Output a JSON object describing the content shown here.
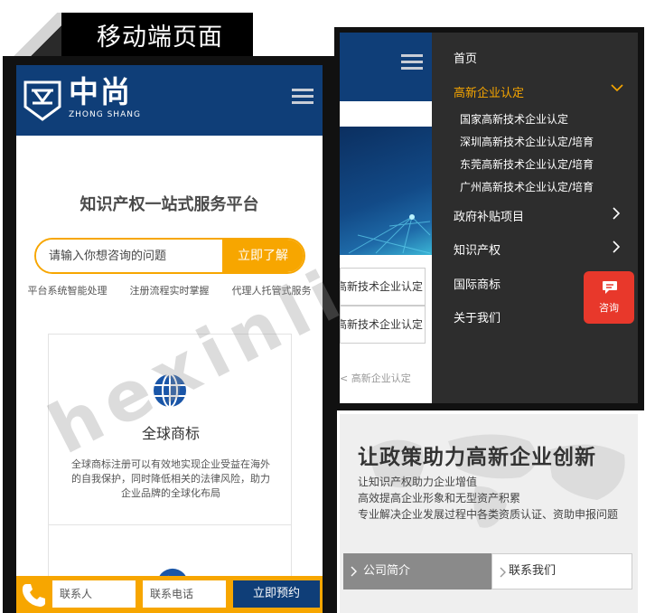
{
  "banner": {
    "title": "移动端页面"
  },
  "left_phone": {
    "logo": {
      "cn": "中尚",
      "en": "ZHONG SHANG"
    },
    "hero_title": "知识产权一站式服务平台",
    "search": {
      "placeholder": "请输入你想咨询的问题",
      "button": "立即了解"
    },
    "features": [
      "平台系统智能处理",
      "注册流程实时掌握",
      "代理人托管式服务"
    ],
    "card": {
      "icon": "globe-icon",
      "title": "全球商标",
      "desc": "全球商标注册可以有效地实现企业受益在海外的自我保护，同时降低相关的法律风险，助力企业品牌的全球化布局"
    },
    "bottom_bar": {
      "name_placeholder": "联系人",
      "phone_placeholder": "联系电话",
      "submit": "立即预约"
    }
  },
  "right_phone": {
    "background_items": [
      "高新技术企业认定/",
      "高新技术企业认定/"
    ],
    "background_more": "高新企业认定 >",
    "menu": {
      "home": "首页",
      "high_tech": "高新企业认定",
      "sub_items": [
        "国家高新技术企业认定",
        "深圳高新技术企业认定/培育",
        "东莞高新技术企业认定/培育",
        "广州高新技术企业认定/培育"
      ],
      "subsidy": "政府补贴项目",
      "ip": "知识产权",
      "trademark": "国际商标",
      "about": "关于我们"
    },
    "consult": "咨询"
  },
  "bottom_banner": {
    "title": "让政策助力高新企业创新",
    "lines": [
      "让知识产权助力企业增值",
      "高效提高企业形象和无型资产积累",
      "专业解决企业发展过程中各类资质认证、资助申报问题"
    ],
    "tab_about": "公司简介",
    "tab_contact": "联系我们"
  },
  "watermark": "hexinli",
  "colors": {
    "brand_blue": "#0f3e78",
    "accent_orange": "#f7a600",
    "drawer_bg": "#2d2d2d",
    "consult_red": "#e8382b"
  }
}
